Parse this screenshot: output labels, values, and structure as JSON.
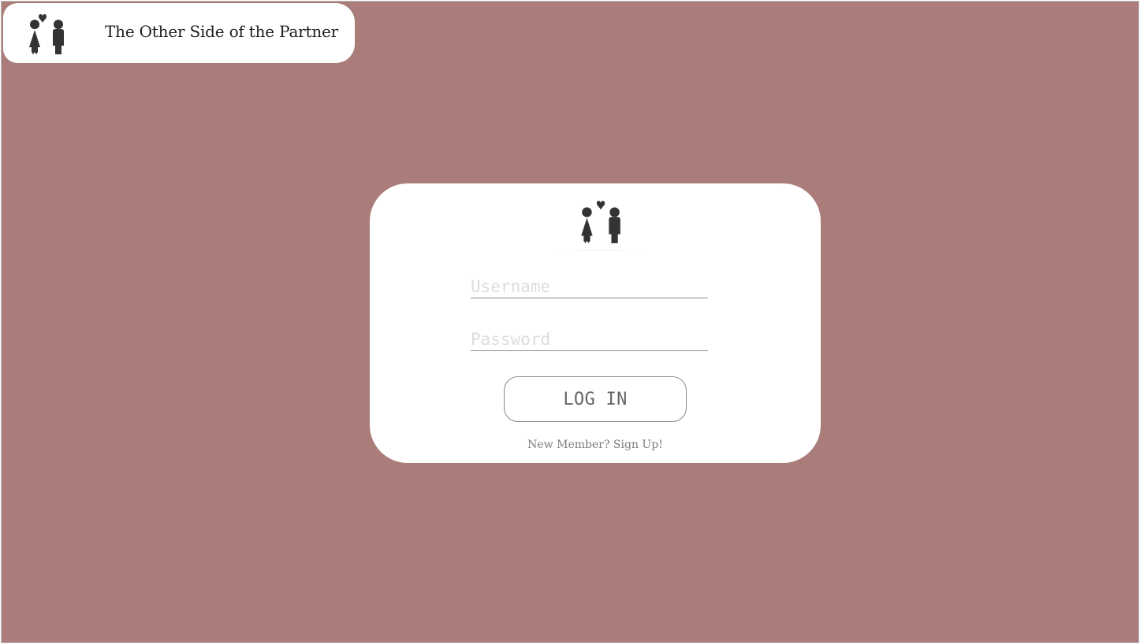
{
  "header": {
    "app_title": "The Other Side of the Partner",
    "logo_icon": "couple-heart-icon"
  },
  "login": {
    "logo_icon": "couple-heart-icon",
    "username_placeholder": "Username",
    "password_placeholder": "Password",
    "login_label": "LOG IN",
    "signup_label": "New Member? Sign Up!"
  },
  "colors": {
    "background": "#aa7d7a",
    "surface": "#ffffff",
    "text": "#1f1f1f",
    "icon": "#333333",
    "muted": "#7c7c7c",
    "placeholder": "#dddddd"
  }
}
